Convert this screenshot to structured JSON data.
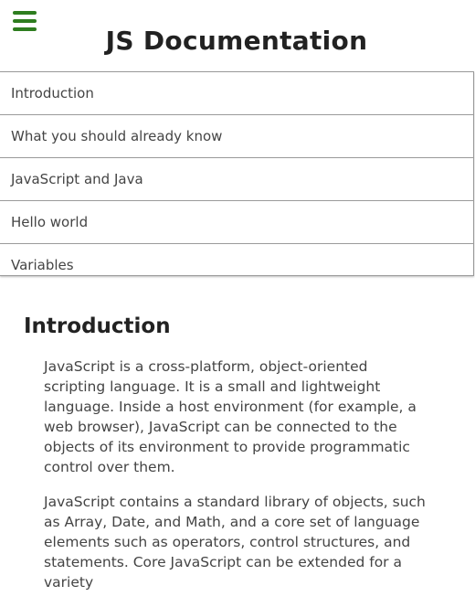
{
  "header": {
    "title": "JS Documentation",
    "menu_icon": "hamburger-menu-icon",
    "accent_color": "#2e7d1f"
  },
  "nav": {
    "items": [
      {
        "label": "Introduction"
      },
      {
        "label": "What you should already know"
      },
      {
        "label": "JavaScript and Java"
      },
      {
        "label": "Hello world"
      },
      {
        "label": "Variables"
      }
    ]
  },
  "main": {
    "section_title": "Introduction",
    "paragraphs": [
      "JavaScript is a cross-platform, object-oriented scripting language. It is a small and lightweight language. Inside a host environment (for example, a web browser), JavaScript can be connected to the objects of its environment to provide programmatic control over them.",
      "JavaScript contains a standard library of objects, such as Array, Date, and Math, and a core set of language elements such as operators, control structures, and statements. Core JavaScript can be extended for a variety"
    ]
  }
}
